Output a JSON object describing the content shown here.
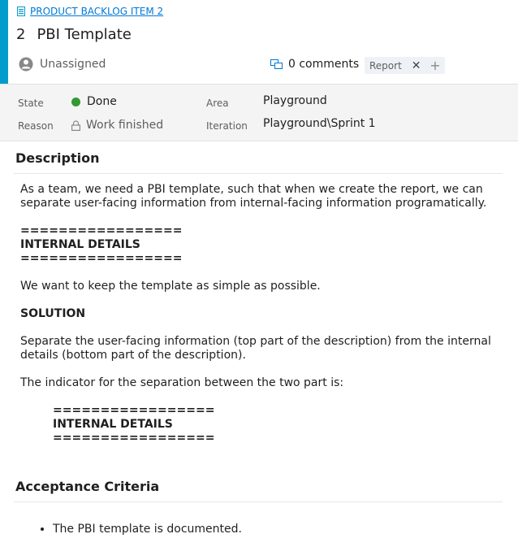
{
  "header": {
    "accent_color": "#009ccc",
    "type_label": "PRODUCT BACKLOG ITEM 2",
    "id": "2",
    "title": "PBI Template",
    "assigned": "Unassigned",
    "comments": "0 comments",
    "tags": [
      "Report"
    ]
  },
  "fields": {
    "state_label": "State",
    "state_value": "Done",
    "state_color": "#339933",
    "reason_label": "Reason",
    "reason_value": "Work finished",
    "area_label": "Area",
    "area_value": "Playground",
    "iteration_label": "Iteration",
    "iteration_value": "Playground\\Sprint 1"
  },
  "description": {
    "title": "Description",
    "para1": "As a team, we need a PBI template, such that when we create the report, we can separate user-facing information from internal-facing information programatically.",
    "rule": "=================",
    "internal": "INTERNAL DETAILS",
    "para2": "We want to keep the template as simple as possible.",
    "solution": "SOLUTION",
    "para3": "Separate the user-facing information (top part of the description) from the internal details (bottom part of the description).",
    "para4": "The indicator for the separation between the two part is:"
  },
  "acceptance": {
    "title": "Acceptance Criteria",
    "items": [
      "The PBI template is documented."
    ]
  }
}
